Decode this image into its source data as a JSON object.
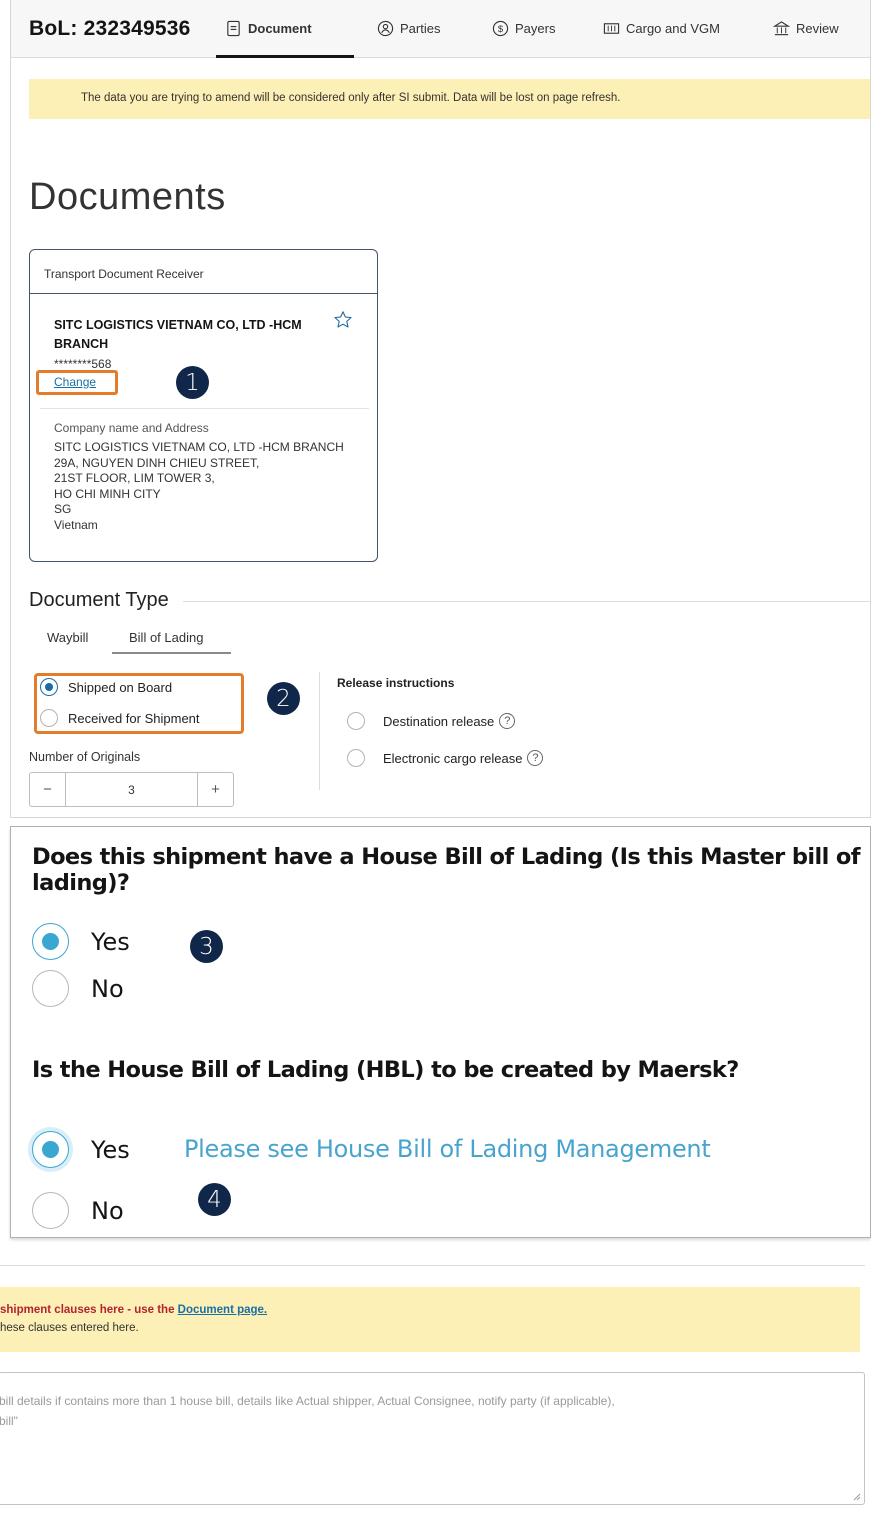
{
  "header": {
    "bol_label": "BoL: 232349536",
    "tabs": [
      {
        "label": "Document",
        "icon": "document-icon",
        "active": true
      },
      {
        "label": "Parties",
        "icon": "parties-icon",
        "active": false
      },
      {
        "label": "Payers",
        "icon": "payers-icon",
        "active": false
      },
      {
        "label": "Cargo and VGM",
        "icon": "cargo-icon",
        "active": false
      },
      {
        "label": "Review",
        "icon": "review-icon",
        "active": false
      }
    ]
  },
  "banner": {
    "text": "The data you are trying to amend will be considered only after SI submit. Data will be lost on page refresh."
  },
  "page_title": "Documents",
  "transport_document_receiver": {
    "heading": "Transport Document Receiver",
    "company_name": "SITC LOGISTICS VIETNAM CO, LTD -HCM BRANCH",
    "masked_id": "********568",
    "change_label": "Change",
    "address_label": "Company name and Address",
    "address_lines": [
      "SITC LOGISTICS VIETNAM CO, LTD -HCM BRANCH",
      "29A, NGUYEN DINH CHIEU STREET,",
      "21ST FLOOR, LIM TOWER 3,",
      "HO CHI MINH CITY",
      "SG",
      "Vietnam"
    ]
  },
  "document_type": {
    "heading": "Document Type",
    "tabs": [
      {
        "label": "Waybill",
        "active": false
      },
      {
        "label": "Bill of Lading",
        "active": true
      }
    ],
    "options": [
      {
        "label": "Shipped on Board",
        "selected": true
      },
      {
        "label": "Received for Shipment",
        "selected": false
      }
    ],
    "release_title": "Release instructions",
    "release_options": [
      {
        "label": "Destination release",
        "selected": false
      },
      {
        "label": "Electronic cargo release",
        "selected": false
      }
    ],
    "originals_label": "Number of Originals",
    "originals_value": "3",
    "minus": "−",
    "plus": "+"
  },
  "hbl": {
    "question1": "Does this shipment have a House Bill of Lading (Is this Master bill of lading)?",
    "q1_options": [
      {
        "label": "Yes",
        "selected": true
      },
      {
        "label": "No",
        "selected": false
      }
    ],
    "question2": "Is the House Bill of Lading (HBL) to be created by Maersk?",
    "q2_options": [
      {
        "label": "Yes",
        "selected": true
      },
      {
        "label": "No",
        "selected": false
      }
    ],
    "management_link": "Please see House Bill of Lading Management"
  },
  "badges": [
    "1",
    "2",
    "3",
    "4"
  ],
  "clauses_banner": {
    "line1": "shipment clauses here - use the ",
    "link": "Document page.",
    "line2": "hese clauses entered here."
  },
  "textarea": {
    "line1": "bill details if contains more than 1 house bill, details like Actual shipper, Actual Consignee, notify party (if applicable),",
    "line2": "bill\""
  },
  "colors": {
    "accent": "#e37d2b",
    "badge": "#10274a",
    "banner": "#fdf0b6",
    "link": "#48a4cf",
    "radio_on": "#1c6ba8"
  }
}
